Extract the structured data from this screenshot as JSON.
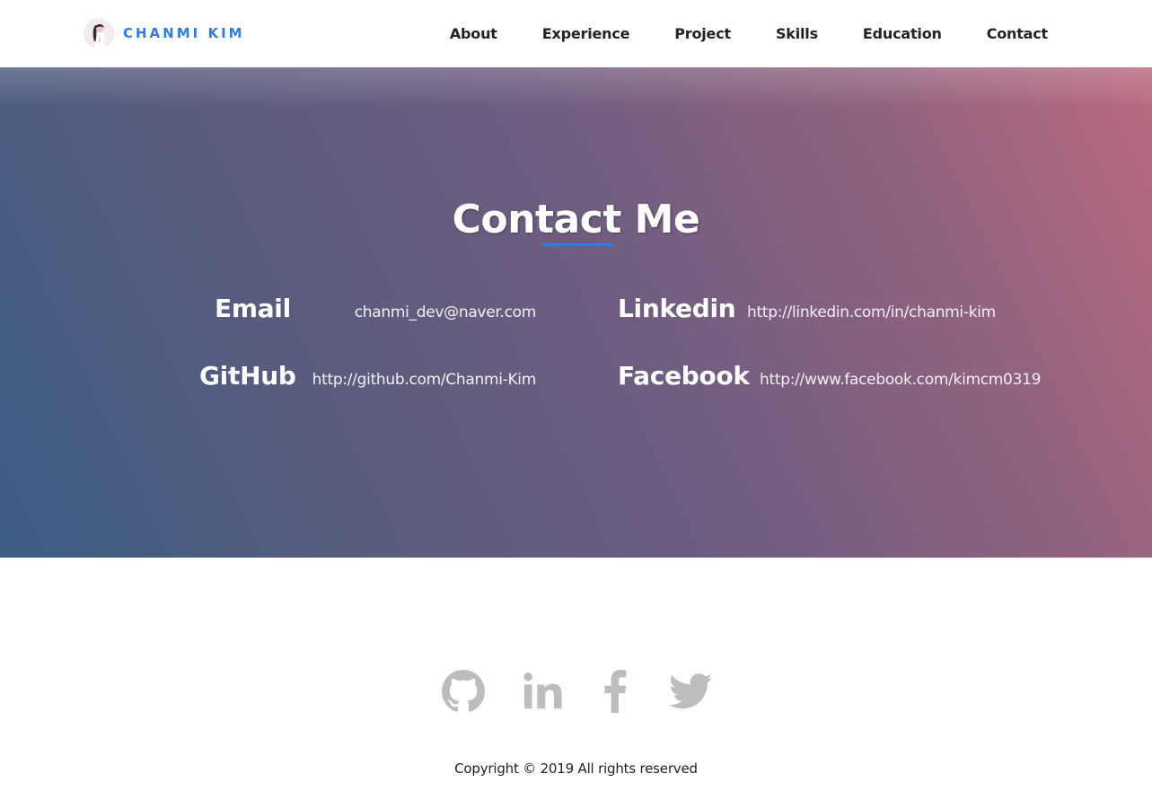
{
  "header": {
    "brand_name": "CHANMI KIM",
    "nav": [
      "About",
      "Experience",
      "Project",
      "Skills",
      "Education",
      "Contact"
    ]
  },
  "contact": {
    "title": "Contact Me",
    "items": [
      {
        "label": "Email",
        "value": "chanmi_dev@naver.com"
      },
      {
        "label": "Linkedin",
        "value": "http://linkedin.com/in/chanmi-kim"
      },
      {
        "label": "GitHub",
        "value": "http://github.com/Chanmi-Kim"
      },
      {
        "label": "Facebook",
        "value": "http://www.facebook.com/kimcm0319"
      }
    ]
  },
  "footer": {
    "social_icons": [
      "github-icon",
      "linkedin-icon",
      "facebook-icon",
      "twitter-icon"
    ],
    "copyright": "Copyright © 2019 All rights reserved"
  },
  "colors": {
    "accent": "#2f7de1",
    "icon_gray": "#bdbdbd",
    "gradient_start": "#3c5d84",
    "gradient_end": "#bb6a80"
  }
}
